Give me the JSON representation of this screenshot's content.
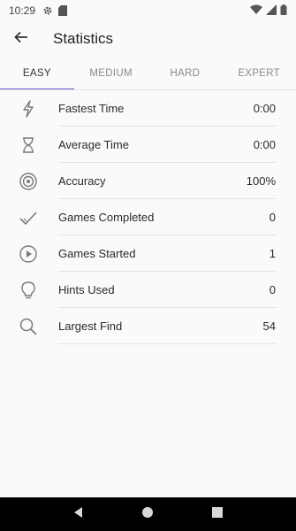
{
  "status_bar": {
    "time": "10:29"
  },
  "app_bar": {
    "title": "Statistics"
  },
  "tabs": [
    {
      "label": "EASY",
      "active": true
    },
    {
      "label": "MEDIUM",
      "active": false
    },
    {
      "label": "HARD",
      "active": false
    },
    {
      "label": "EXPERT",
      "active": false
    }
  ],
  "stats": [
    {
      "label": "Fastest Time",
      "value": "0:00",
      "icon": "lightning-icon"
    },
    {
      "label": "Average Time",
      "value": "0:00",
      "icon": "hourglass-icon"
    },
    {
      "label": "Accuracy",
      "value": "100%",
      "icon": "target-icon"
    },
    {
      "label": "Games Completed",
      "value": "0",
      "icon": "checkmark-icon"
    },
    {
      "label": "Games Started",
      "value": "1",
      "icon": "play-circle-icon"
    },
    {
      "label": "Hints Used",
      "value": "0",
      "icon": "lightbulb-icon"
    },
    {
      "label": "Largest Find",
      "value": "54",
      "icon": "magnifier-icon"
    }
  ],
  "colors": {
    "accent": "#6b57c9",
    "icon": "#7a7a7a",
    "nav_bar": "#000000"
  }
}
